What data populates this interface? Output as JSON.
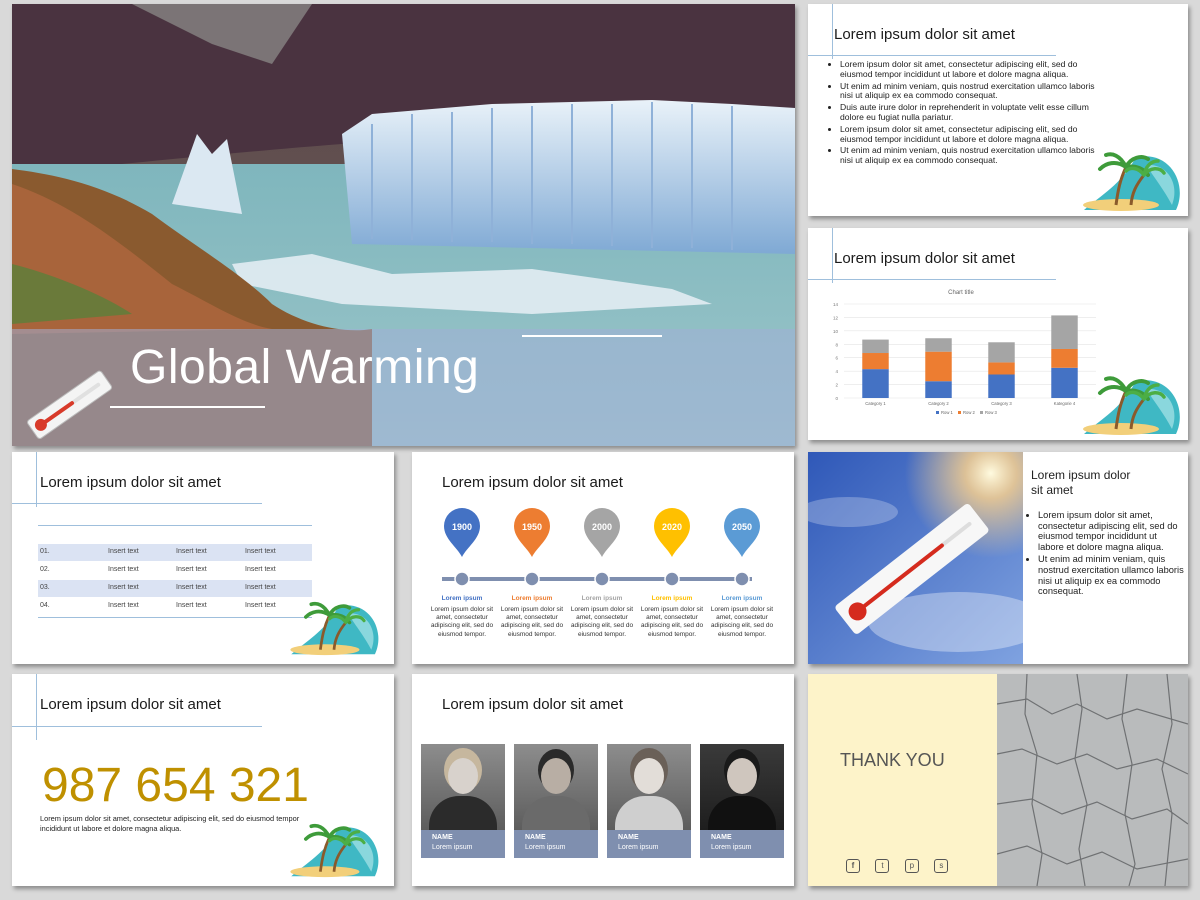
{
  "slide1": {
    "title": "Global Warming"
  },
  "slide2": {
    "title": "Lorem ipsum dolor sit amet",
    "bullets": [
      "Lorem ipsum dolor sit amet, consectetur adipiscing elit, sed do eiusmod tempor incididunt ut labore et dolore magna aliqua.",
      "Ut enim ad minim veniam, quis nostrud exercitation ullamco laboris nisi ut aliquip ex ea commodo consequat.",
      "Duis aute irure dolor in reprehenderit in voluptate velit esse cillum dolore eu fugiat nulla pariatur.",
      "Lorem ipsum dolor sit amet, consectetur adipiscing elit, sed do eiusmod tempor incididunt ut labore et dolore magna aliqua.",
      "Ut enim ad minim veniam, quis nostrud exercitation ullamco laboris nisi ut aliquip ex ea commodo consequat."
    ]
  },
  "slide3": {
    "title": "Lorem ipsum dolor sit amet",
    "chart_data": {
      "type": "bar",
      "stacked": true,
      "title": "Chart title",
      "categories": [
        "Category 1",
        "Category 2",
        "Category 3",
        "Kategorie 4"
      ],
      "series": [
        {
          "name": "Row 1",
          "values": [
            4.3,
            2.5,
            3.5,
            4.5
          ],
          "color": "#4472c4"
        },
        {
          "name": "Row 2",
          "values": [
            2.4,
            4.4,
            1.8,
            2.8
          ],
          "color": "#ed7d31"
        },
        {
          "name": "Row 3",
          "values": [
            2.0,
            2.0,
            3.0,
            5.0
          ],
          "color": "#a5a5a5"
        }
      ],
      "ylim": [
        0,
        14
      ],
      "yticks": [
        "0",
        "2",
        "4",
        "6",
        "8",
        "10",
        "12",
        "14"
      ],
      "grid": true,
      "legend": "bottom"
    }
  },
  "slide4": {
    "title": "Lorem ipsum dolor sit amet",
    "rows": [
      {
        "num": "01.",
        "cells": [
          "Insert text",
          "Insert text",
          "Insert text"
        ]
      },
      {
        "num": "02.",
        "cells": [
          "Insert text",
          "Insert text",
          "Insert text"
        ]
      },
      {
        "num": "03.",
        "cells": [
          "Insert text",
          "Insert text",
          "Insert text"
        ]
      },
      {
        "num": "04.",
        "cells": [
          "Insert text",
          "Insert text",
          "Insert text"
        ]
      }
    ]
  },
  "slide5": {
    "title": "Lorem ipsum dolor sit amet",
    "items": [
      {
        "year": "1900",
        "color": "#4472c4",
        "heading": "Lorem ipsum",
        "text": "Lorem ipsum dolor sit amet, consectetur adipiscing elit, sed do eiusmod tempor."
      },
      {
        "year": "1950",
        "color": "#ed7d31",
        "heading": "Lorem ipsum",
        "text": "Lorem ipsum dolor sit amet, consectetur adipiscing elit, sed do eiusmod tempor."
      },
      {
        "year": "2000",
        "color": "#a5a5a5",
        "heading": "Lorem ipsum",
        "text": "Lorem ipsum dolor sit amet, consectetur adipiscing elit, sed do eiusmod tempor."
      },
      {
        "year": "2020",
        "color": "#ffc000",
        "heading": "Lorem ipsum",
        "text": "Lorem ipsum dolor sit amet, consectetur adipiscing elit, sed do eiusmod tempor."
      },
      {
        "year": "2050",
        "color": "#5b9bd5",
        "heading": "Lorem ipsum",
        "text": "Lorem ipsum dolor sit amet, consectetur adipiscing elit, sed do eiusmod tempor."
      }
    ]
  },
  "slide6": {
    "title": "Lorem ipsum dolor sit amet",
    "bullets": [
      "Lorem ipsum dolor sit amet, consectetur adipiscing elit, sed do eiusmod tempor incididunt ut labore et dolore magna aliqua.",
      "Ut enim ad minim veniam, quis nostrud exercitation ullamco laboris nisi ut aliquip ex ea commodo consequat."
    ]
  },
  "slide7": {
    "title": "Lorem ipsum dolor sit amet",
    "number": "987 654 321",
    "text": "Lorem ipsum dolor sit amet, consectetur adipiscing elit, sed do eiusmod tempor incididunt ut labore et dolore magna aliqua."
  },
  "slide8": {
    "title": "Lorem ipsum dolor sit amet",
    "people": [
      {
        "name": "NAME",
        "role": "Lorem ipsum"
      },
      {
        "name": "NAME",
        "role": "Lorem ipsum"
      },
      {
        "name": "NAME",
        "role": "Lorem ipsum"
      },
      {
        "name": "NAME",
        "role": "Lorem ipsum"
      }
    ]
  },
  "slide9": {
    "title": "THANK YOU",
    "social_icons": [
      "facebook-icon",
      "twitter-icon",
      "pinterest-icon",
      "skype-icon"
    ]
  },
  "colors": {
    "accent_line": "#9fbfdc",
    "gold_number": "#bf9000",
    "thank_you_bg": "#fdf3c9",
    "team_caption": "#7f8faf"
  }
}
